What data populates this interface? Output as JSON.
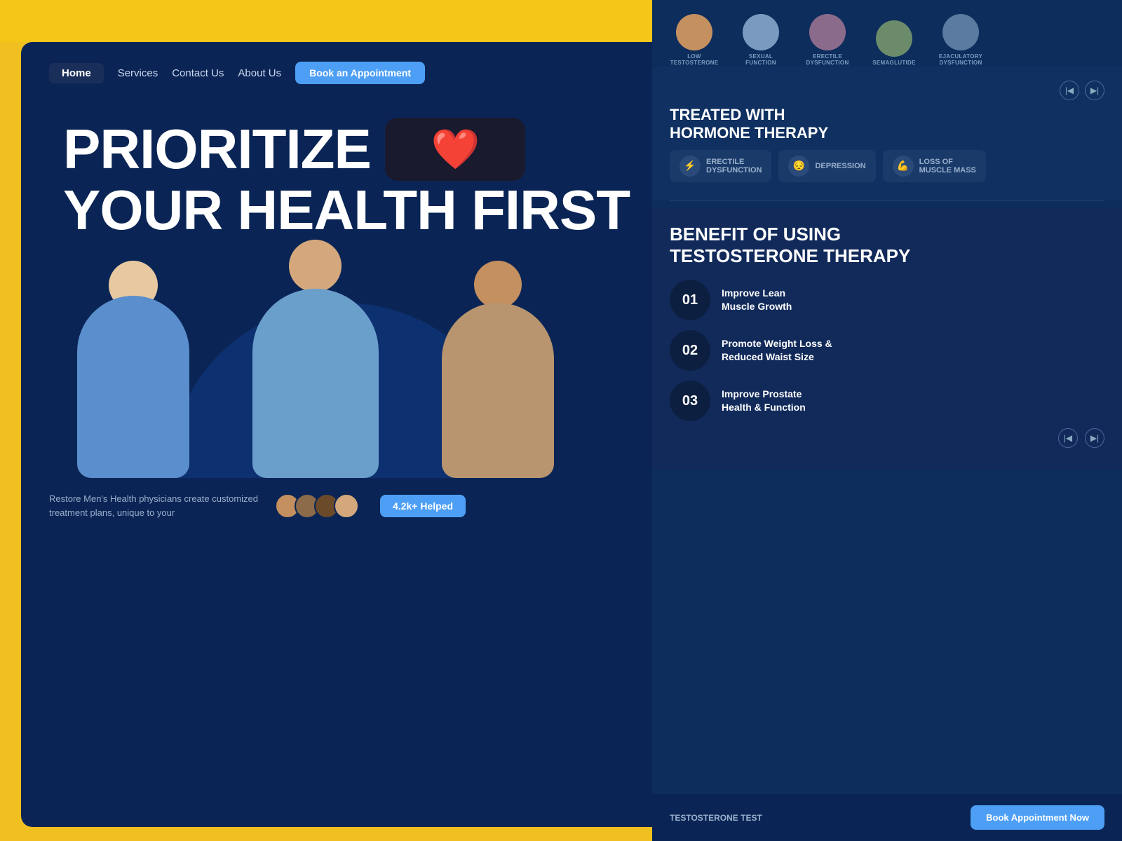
{
  "page": {
    "background_color": "#f5c518"
  },
  "nav": {
    "home_label": "Home",
    "services_label": "Services",
    "contact_label": "Contact Us",
    "about_label": "About Us",
    "book_label": "Book an Appointment"
  },
  "hero": {
    "title_line1": "PRIORITIZE",
    "title_line2": "YOUR HEALTH FIRST",
    "heart_emoji": "❤️"
  },
  "footer_section": {
    "description": "Restore Men's Health physicians create customized treatment plans, unique to your",
    "helped_badge": "4.2k+ Helped"
  },
  "right_panel": {
    "conditions_top": [
      {
        "label": "LOW\nTESTOSTERONE",
        "avatar_class": "c1"
      },
      {
        "label": "SEXUAL\nFUNCTION",
        "avatar_class": "c2"
      },
      {
        "label": "ERECTILE\nDYSFUNCTION",
        "avatar_class": "c3"
      },
      {
        "label": "SEMAGLUTIDE",
        "avatar_class": "c4"
      },
      {
        "label": "EJACULATORY\nDYSFUNCTION",
        "avatar_class": "c5"
      }
    ],
    "treated_title_line1": "TREATED WITH",
    "treated_title_line2": "HORMONE THERAPY",
    "condition_tags": [
      {
        "label": "ERECTILE\nDYSFUNCTION",
        "icon": "⚡"
      },
      {
        "label": "DEPRESSION",
        "icon": "😔"
      },
      {
        "label": "LOSS OF\nMUSCLE MASS",
        "icon": "💪"
      }
    ],
    "benefit_title_line1": "BENEFIT OF USING",
    "benefit_title_line2": "TESTOSTERONE THERAPY",
    "benefits": [
      {
        "number": "01",
        "text": "Improve Lean\nMuscle Growth"
      },
      {
        "number": "02",
        "text": "Promote Weight Loss &\nReduced Waist Size"
      },
      {
        "number": "03",
        "text": "Improve Prostate\nHealth & Function"
      }
    ],
    "footer_test_label": "TESTOSTERONE TEST",
    "footer_book_label": "Book Appointment Now"
  }
}
